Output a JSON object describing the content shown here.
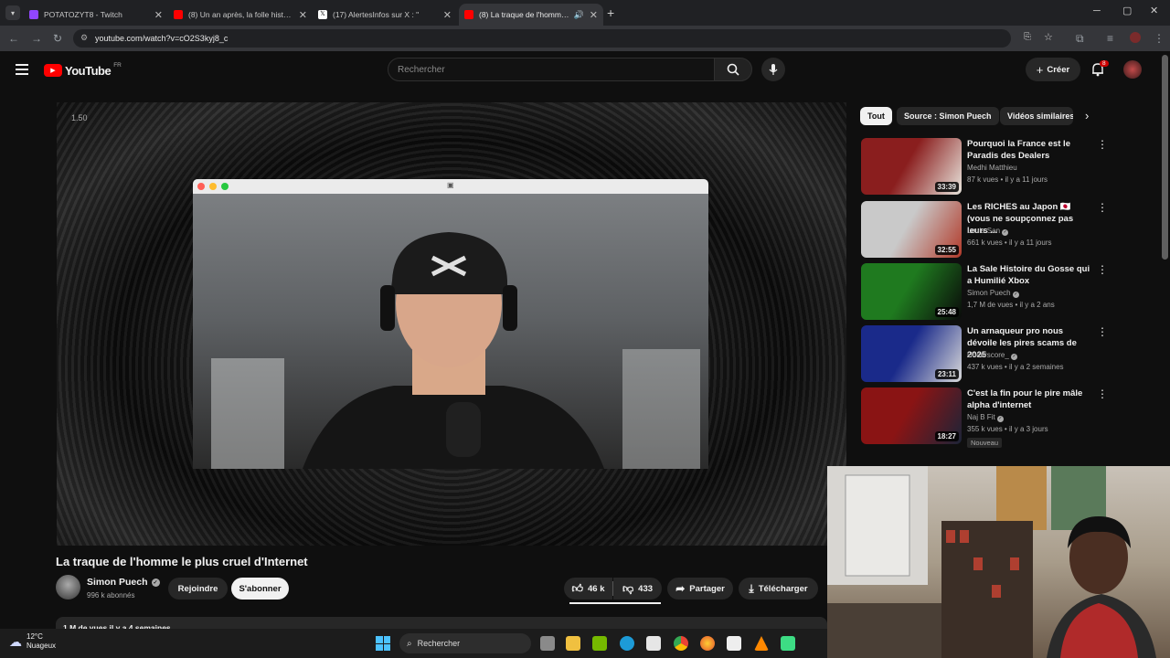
{
  "browser": {
    "tabs": [
      {
        "label": "POTATOZYT8 - Twitch",
        "color": "#9146ff"
      },
      {
        "label": "(8) Un an après, la folle histoire",
        "color": "#ff0000"
      },
      {
        "label": "(17) AlertesInfos sur X : \"",
        "color": "#ffffff"
      },
      {
        "label": "(8) La traque de l'homme le",
        "color": "#ff0000"
      }
    ],
    "url": "youtube.com/watch?v=cO2S3kyj8_c"
  },
  "yt": {
    "logo": "YouTube",
    "region": "FR",
    "search_placeholder": "Rechercher",
    "create_label": "Créer",
    "notif_count": "8"
  },
  "video": {
    "time_overlay": "1.50",
    "title": "La traque de l'homme le plus cruel d'Internet",
    "channel": "Simon Puech",
    "subscribers": "996 k abonnés",
    "join_label": "Rejoindre",
    "subscribe_label": "S'abonner",
    "likes": "46 k",
    "dislikes": "433",
    "share_label": "Partager",
    "download_label": "Télécharger",
    "views_partial": "1 M de vues  il y a 4 semaines"
  },
  "chips": [
    "Tout",
    "Source : Simon Puech",
    "Vidéos similaires"
  ],
  "recommendations": [
    {
      "title": "Pourquoi la France est le Paradis des Dealers",
      "channel": "Medhi Matthieu",
      "meta": "87 k vues • il y a 11 jours",
      "duration": "33:39",
      "verified": false,
      "badge": "",
      "c1": "#8a1e1e",
      "c2": "#e8e4dc"
    },
    {
      "title": "Les RICHES au Japon 🇯🇵 (vous ne soupçonnez pas leurs ...",
      "channel": "Louis-San",
      "meta": "661 k vues • il y a 11 jours",
      "duration": "32:55",
      "verified": true,
      "badge": "",
      "c1": "#c9c9c9",
      "c2": "#b23a2a"
    },
    {
      "title": "La Sale Histoire du Gosse qui a Humilié Xbox",
      "channel": "Simon Puech",
      "meta": "1,7 M de vues • il y a 2 ans",
      "duration": "25:48",
      "verified": true,
      "badge": "",
      "c1": "#1f7a1f",
      "c2": "#0a0a0a"
    },
    {
      "title": "Un arnaqueur pro nous dévoile les pires scams de 2025",
      "channel": "Underscore_",
      "meta": "437 k vues • il y a 2 semaines",
      "duration": "23:11",
      "verified": true,
      "badge": "",
      "c1": "#1a2a8a",
      "c2": "#d9d9d9"
    },
    {
      "title": "C'est la fin pour le pire mâle alpha d'internet",
      "channel": "Naj B Fit",
      "meta": "355 k vues • il y a 3 jours",
      "duration": "18:27",
      "verified": true,
      "badge": "Nouveau",
      "c1": "#8a1414",
      "c2": "#1b2438"
    }
  ],
  "taskbar": {
    "temp": "12°C",
    "weather": "Nuageux",
    "search_label": "Rechercher"
  }
}
